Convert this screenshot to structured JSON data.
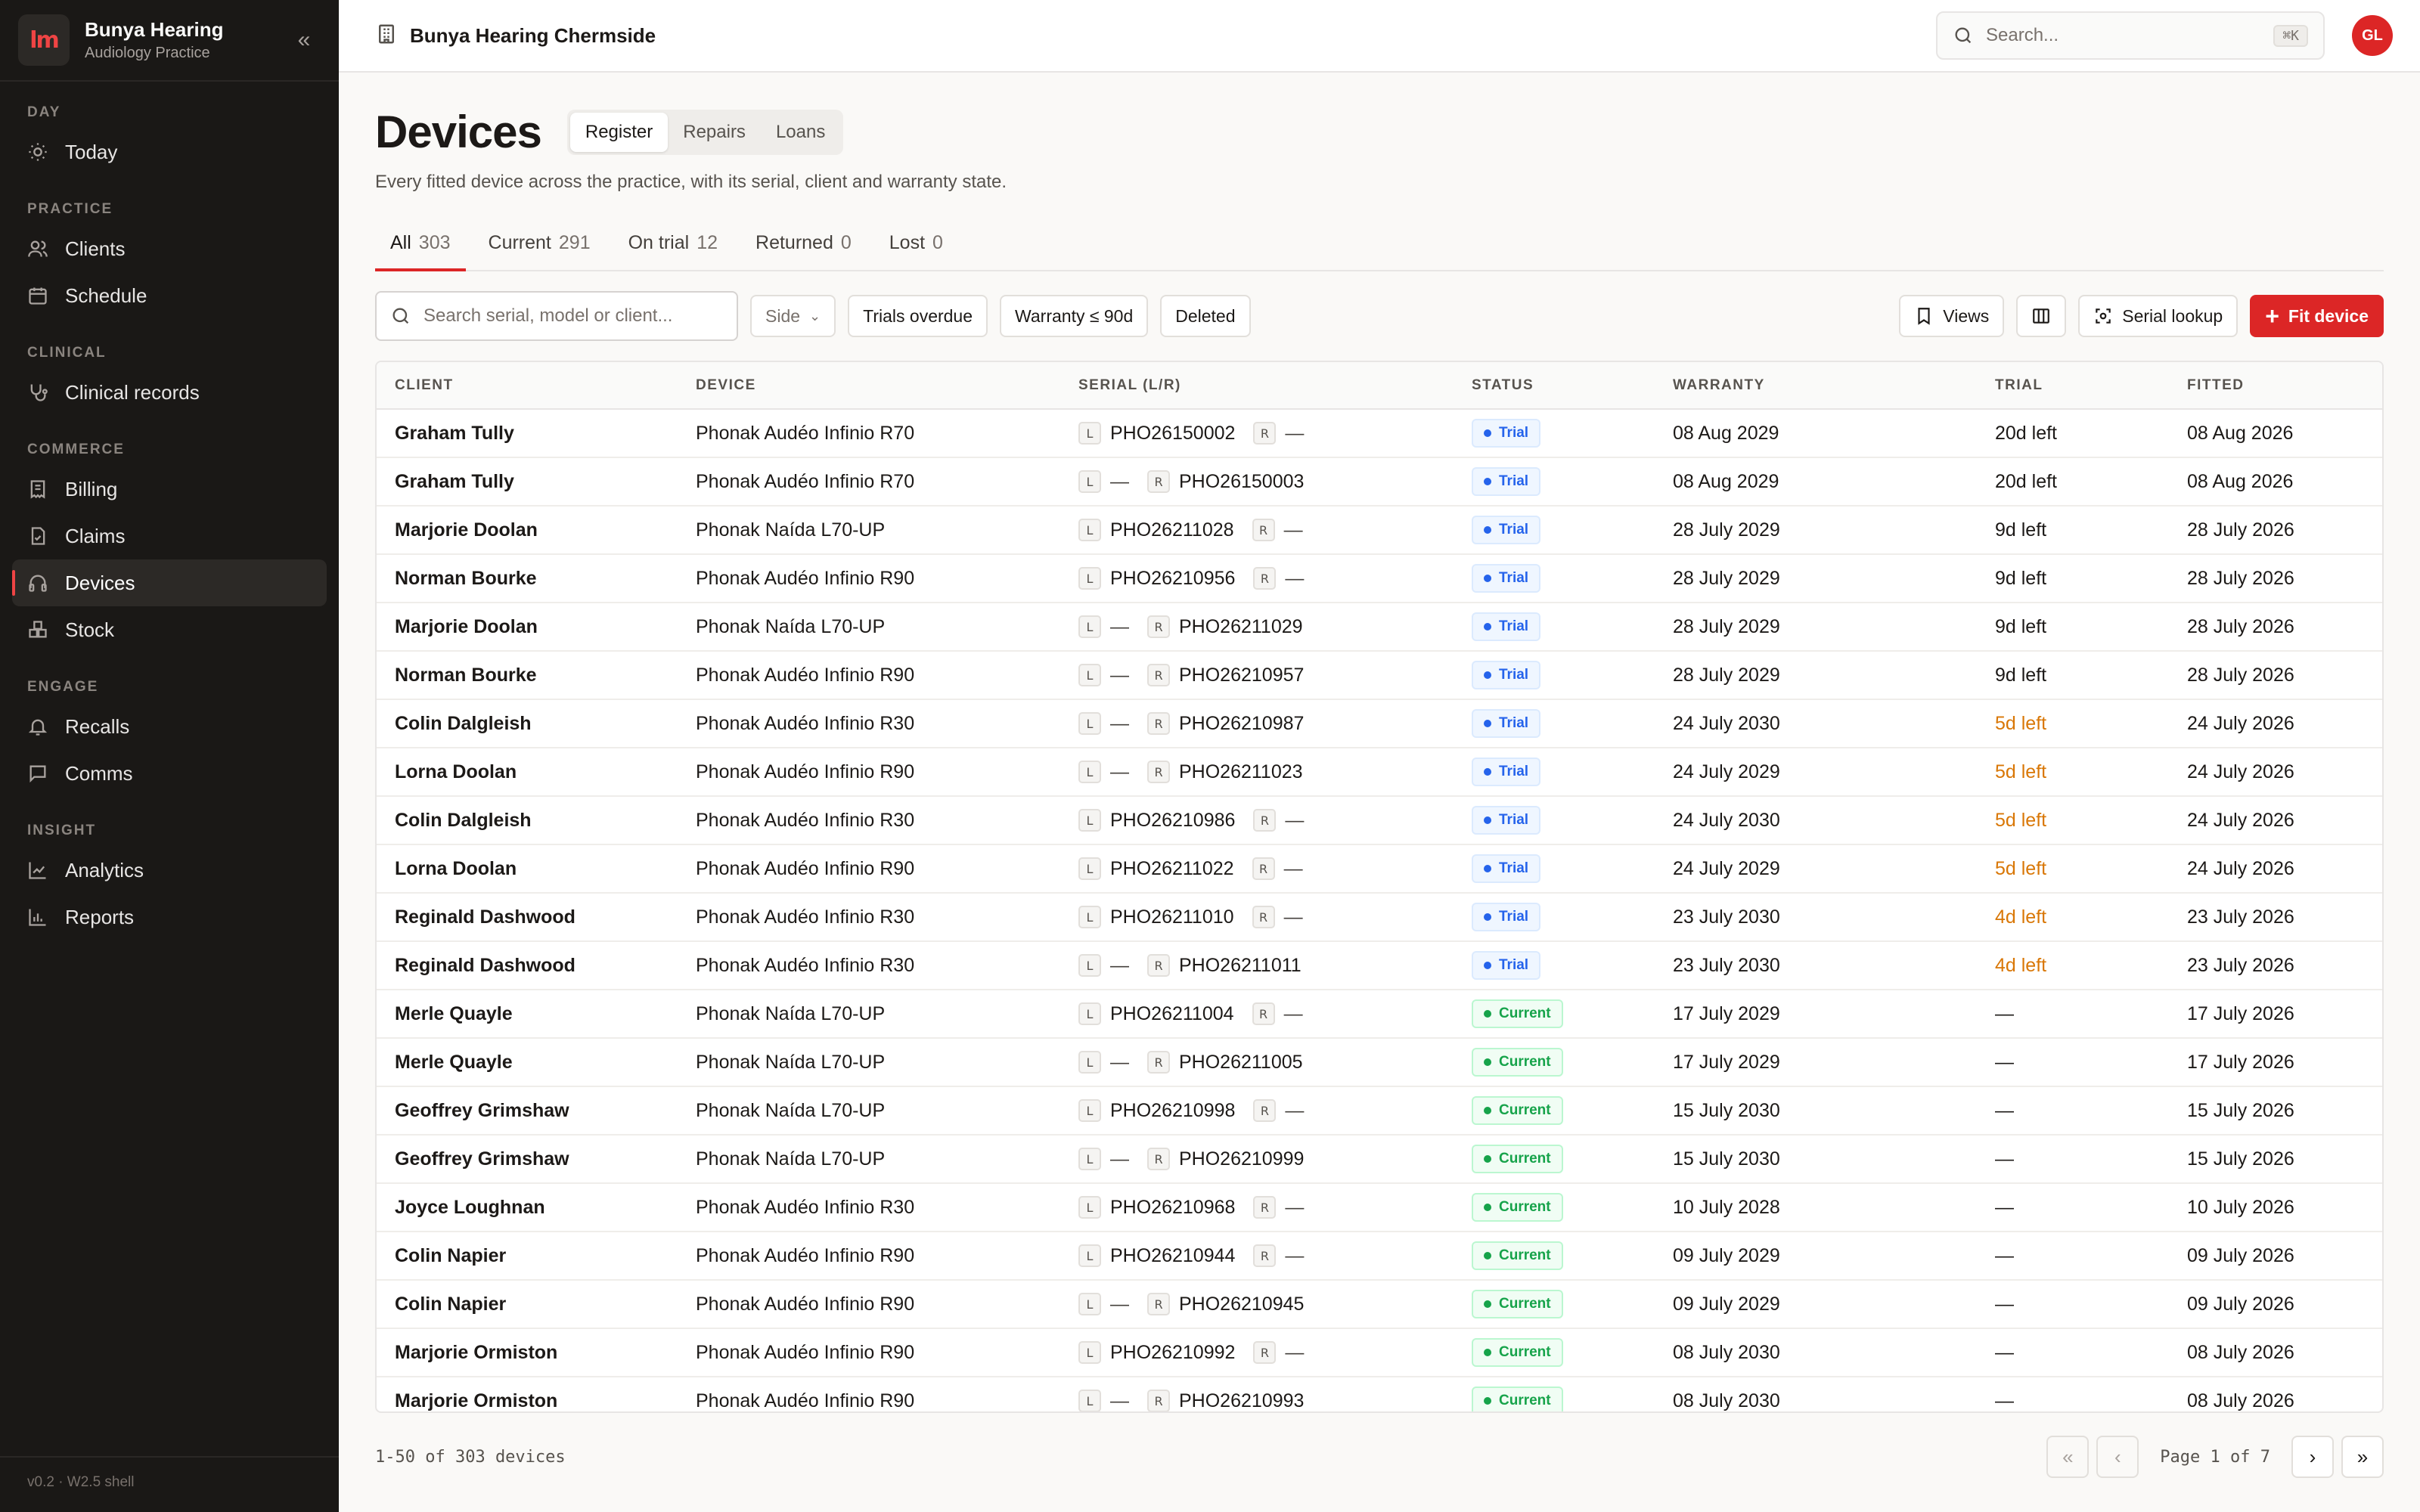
{
  "brand": {
    "logo_text": "lm",
    "name": "Bunya Hearing",
    "subtitle": "Audiology Practice"
  },
  "sidebar": {
    "sections": [
      {
        "heading": "DAY",
        "items": [
          {
            "label": "Today",
            "icon": "sun-icon"
          }
        ]
      },
      {
        "heading": "PRACTICE",
        "items": [
          {
            "label": "Clients",
            "icon": "users-icon"
          },
          {
            "label": "Schedule",
            "icon": "calendar-icon"
          }
        ]
      },
      {
        "heading": "CLINICAL",
        "items": [
          {
            "label": "Clinical records",
            "icon": "stethoscope-icon"
          }
        ]
      },
      {
        "heading": "COMMERCE",
        "items": [
          {
            "label": "Billing",
            "icon": "receipt-icon"
          },
          {
            "label": "Claims",
            "icon": "file-check-icon"
          },
          {
            "label": "Devices",
            "icon": "headphones-icon",
            "active": true
          },
          {
            "label": "Stock",
            "icon": "boxes-icon"
          }
        ]
      },
      {
        "heading": "ENGAGE",
        "items": [
          {
            "label": "Recalls",
            "icon": "bell-icon"
          },
          {
            "label": "Comms",
            "icon": "message-icon"
          }
        ]
      },
      {
        "heading": "INSIGHT",
        "items": [
          {
            "label": "Analytics",
            "icon": "line-chart-icon"
          },
          {
            "label": "Reports",
            "icon": "bar-chart-icon"
          }
        ]
      }
    ],
    "version": "v0.2 · W2.5 shell"
  },
  "header": {
    "location": "Bunya Hearing Chermside",
    "search_placeholder": "Search...",
    "search_shortcut": "⌘K",
    "avatar_initials": "GL"
  },
  "page": {
    "title": "Devices",
    "segments": [
      "Register",
      "Repairs",
      "Loans"
    ],
    "subtitle": "Every fitted device across the practice, with its serial, client and warranty state.",
    "tabs": [
      {
        "label": "All",
        "count": "303"
      },
      {
        "label": "Current",
        "count": "291"
      },
      {
        "label": "On trial",
        "count": "12"
      },
      {
        "label": "Returned",
        "count": "0"
      },
      {
        "label": "Lost",
        "count": "0"
      }
    ]
  },
  "toolbar": {
    "search_placeholder": "Search serial, model or client...",
    "side_label": "Side",
    "filters": [
      "Trials overdue",
      "Warranty ≤ 90d",
      "Deleted"
    ],
    "views_label": "Views",
    "serial_lookup_label": "Serial lookup",
    "fit_device_label": "Fit device"
  },
  "table": {
    "columns": [
      "CLIENT",
      "DEVICE",
      "SERIAL (L/R)",
      "STATUS",
      "WARRANTY",
      "TRIAL",
      "FITTED"
    ],
    "side_left": "L",
    "side_right": "R",
    "rows": [
      {
        "client": "Graham Tully",
        "device": "Phonak Audéo Infinio R70",
        "left": "PHO26150002",
        "right": "—",
        "status": "Trial",
        "warranty": "08 Aug 2029",
        "trial": "20d left",
        "fitted": "08 Aug 2026",
        "warn": false
      },
      {
        "client": "Graham Tully",
        "device": "Phonak Audéo Infinio R70",
        "left": "—",
        "right": "PHO26150003",
        "status": "Trial",
        "warranty": "08 Aug 2029",
        "trial": "20d left",
        "fitted": "08 Aug 2026",
        "warn": false
      },
      {
        "client": "Marjorie Doolan",
        "device": "Phonak Naída L70-UP",
        "left": "PHO26211028",
        "right": "—",
        "status": "Trial",
        "warranty": "28 July 2029",
        "trial": "9d left",
        "fitted": "28 July 2026",
        "warn": false
      },
      {
        "client": "Norman Bourke",
        "device": "Phonak Audéo Infinio R90",
        "left": "PHO26210956",
        "right": "—",
        "status": "Trial",
        "warranty": "28 July 2029",
        "trial": "9d left",
        "fitted": "28 July 2026",
        "warn": false
      },
      {
        "client": "Marjorie Doolan",
        "device": "Phonak Naída L70-UP",
        "left": "—",
        "right": "PHO26211029",
        "status": "Trial",
        "warranty": "28 July 2029",
        "trial": "9d left",
        "fitted": "28 July 2026",
        "warn": false
      },
      {
        "client": "Norman Bourke",
        "device": "Phonak Audéo Infinio R90",
        "left": "—",
        "right": "PHO26210957",
        "status": "Trial",
        "warranty": "28 July 2029",
        "trial": "9d left",
        "fitted": "28 July 2026",
        "warn": false
      },
      {
        "client": "Colin Dalgleish",
        "device": "Phonak Audéo Infinio R30",
        "left": "—",
        "right": "PHO26210987",
        "status": "Trial",
        "warranty": "24 July 2030",
        "trial": "5d left",
        "fitted": "24 July 2026",
        "warn": true
      },
      {
        "client": "Lorna Doolan",
        "device": "Phonak Audéo Infinio R90",
        "left": "—",
        "right": "PHO26211023",
        "status": "Trial",
        "warranty": "24 July 2029",
        "trial": "5d left",
        "fitted": "24 July 2026",
        "warn": true
      },
      {
        "client": "Colin Dalgleish",
        "device": "Phonak Audéo Infinio R30",
        "left": "PHO26210986",
        "right": "—",
        "status": "Trial",
        "warranty": "24 July 2030",
        "trial": "5d left",
        "fitted": "24 July 2026",
        "warn": true
      },
      {
        "client": "Lorna Doolan",
        "device": "Phonak Audéo Infinio R90",
        "left": "PHO26211022",
        "right": "—",
        "status": "Trial",
        "warranty": "24 July 2029",
        "trial": "5d left",
        "fitted": "24 July 2026",
        "warn": true
      },
      {
        "client": "Reginald Dashwood",
        "device": "Phonak Audéo Infinio R30",
        "left": "PHO26211010",
        "right": "—",
        "status": "Trial",
        "warranty": "23 July 2030",
        "trial": "4d left",
        "fitted": "23 July 2026",
        "warn": true
      },
      {
        "client": "Reginald Dashwood",
        "device": "Phonak Audéo Infinio R30",
        "left": "—",
        "right": "PHO26211011",
        "status": "Trial",
        "warranty": "23 July 2030",
        "trial": "4d left",
        "fitted": "23 July 2026",
        "warn": true
      },
      {
        "client": "Merle Quayle",
        "device": "Phonak Naída L70-UP",
        "left": "PHO26211004",
        "right": "—",
        "status": "Current",
        "warranty": "17 July 2029",
        "trial": "—",
        "fitted": "17 July 2026",
        "warn": false
      },
      {
        "client": "Merle Quayle",
        "device": "Phonak Naída L70-UP",
        "left": "—",
        "right": "PHO26211005",
        "status": "Current",
        "warranty": "17 July 2029",
        "trial": "—",
        "fitted": "17 July 2026",
        "warn": false
      },
      {
        "client": "Geoffrey Grimshaw",
        "device": "Phonak Naída L70-UP",
        "left": "PHO26210998",
        "right": "—",
        "status": "Current",
        "warranty": "15 July 2030",
        "trial": "—",
        "fitted": "15 July 2026",
        "warn": false
      },
      {
        "client": "Geoffrey Grimshaw",
        "device": "Phonak Naída L70-UP",
        "left": "—",
        "right": "PHO26210999",
        "status": "Current",
        "warranty": "15 July 2030",
        "trial": "—",
        "fitted": "15 July 2026",
        "warn": false
      },
      {
        "client": "Joyce Loughnan",
        "device": "Phonak Audéo Infinio R30",
        "left": "PHO26210968",
        "right": "—",
        "status": "Current",
        "warranty": "10 July 2028",
        "trial": "—",
        "fitted": "10 July 2026",
        "warn": false
      },
      {
        "client": "Colin Napier",
        "device": "Phonak Audéo Infinio R90",
        "left": "PHO26210944",
        "right": "—",
        "status": "Current",
        "warranty": "09 July 2029",
        "trial": "—",
        "fitted": "09 July 2026",
        "warn": false
      },
      {
        "client": "Colin Napier",
        "device": "Phonak Audéo Infinio R90",
        "left": "—",
        "right": "PHO26210945",
        "status": "Current",
        "warranty": "09 July 2029",
        "trial": "—",
        "fitted": "09 July 2026",
        "warn": false
      },
      {
        "client": "Marjorie Ormiston",
        "device": "Phonak Audéo Infinio R90",
        "left": "PHO26210992",
        "right": "—",
        "status": "Current",
        "warranty": "08 July 2030",
        "trial": "—",
        "fitted": "08 July 2026",
        "warn": false
      },
      {
        "client": "Marjorie Ormiston",
        "device": "Phonak Audéo Infinio R90",
        "left": "—",
        "right": "PHO26210993",
        "status": "Current",
        "warranty": "08 July 2030",
        "trial": "—",
        "fitted": "08 July 2026",
        "warn": false
      }
    ]
  },
  "pagination": {
    "range_text": "1-50 of 303 devices",
    "page_text": "Page 1 of 7",
    "first": "«",
    "prev": "‹",
    "next": "›",
    "last": "»"
  }
}
